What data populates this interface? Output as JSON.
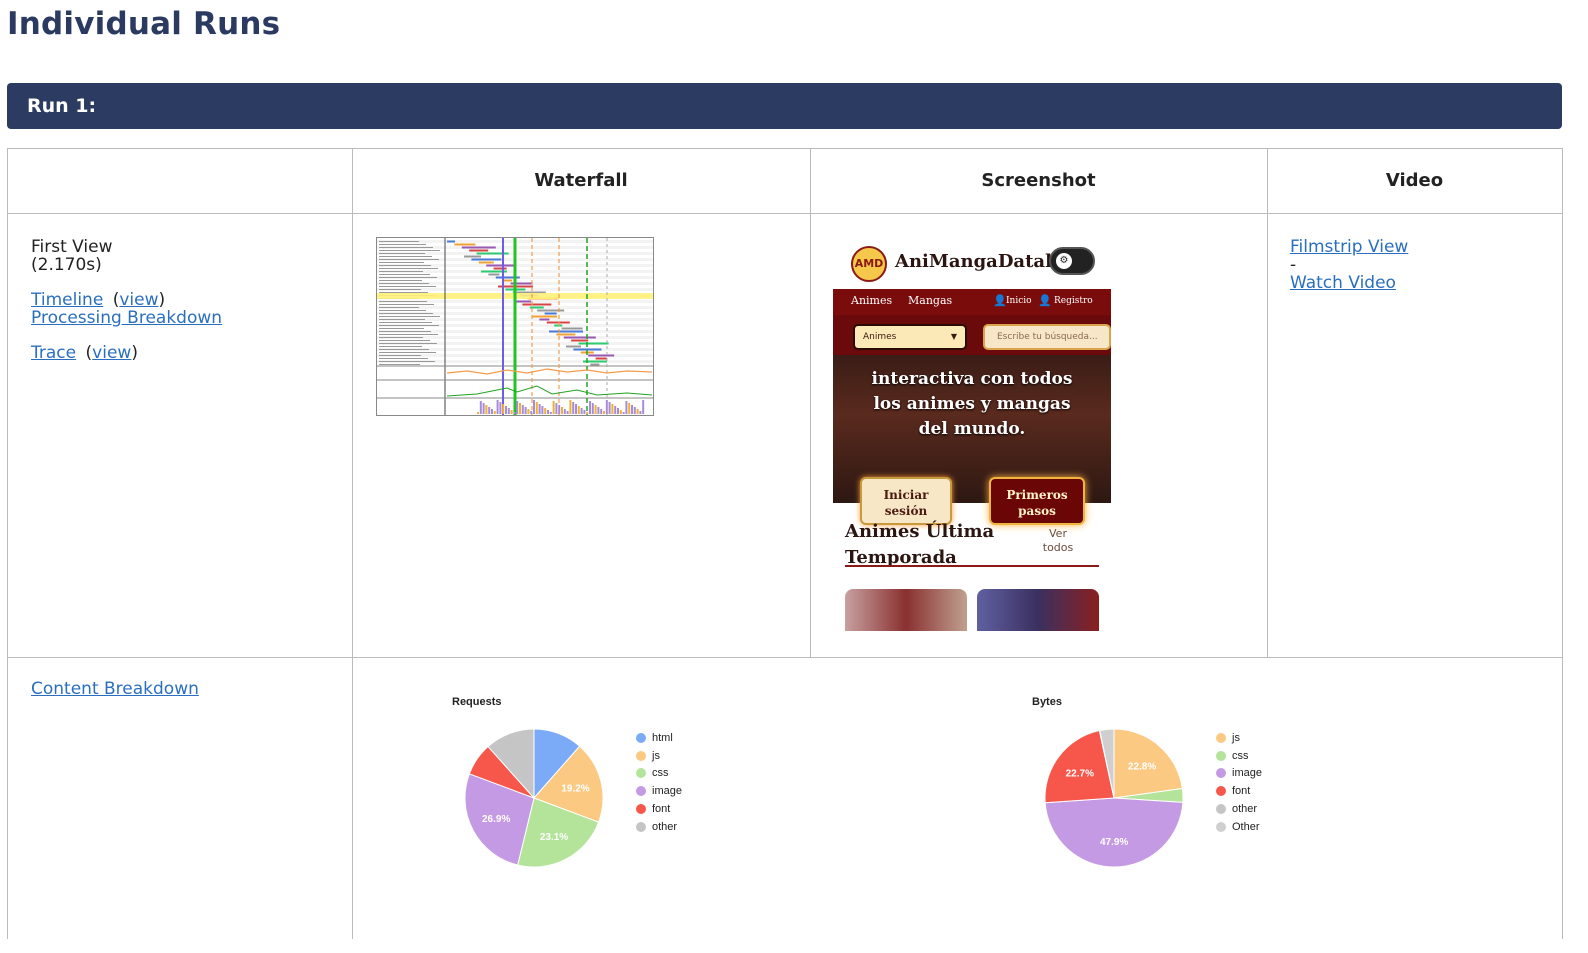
{
  "page_title": "Individual Runs",
  "run": {
    "label": "Run 1:"
  },
  "table": {
    "headers": [
      "Waterfall",
      "Screenshot",
      "Video"
    ],
    "first_view": {
      "label": "First View",
      "time": "(2.170s)",
      "timeline_link": "Timeline",
      "view_link": "view",
      "processing_link": "Processing Breakdown",
      "trace_link": "Trace",
      "trace_view_link": "view",
      "open_paren": "(",
      "close_paren": ")"
    },
    "video": {
      "filmstrip_link": "Filmstrip View",
      "separator": "-",
      "watch_link": "Watch Video"
    },
    "content_breakdown_link": "Content Breakdown"
  },
  "screenshot": {
    "brand": "AniMangaDatahub",
    "logo_text": "AMD",
    "nav": [
      "Animes",
      "Mangas",
      "Inicio",
      "Registro"
    ],
    "select_value": "Animes",
    "search_placeholder": "Escribe tu búsqueda...",
    "hero_line1": "interactiva con todos",
    "hero_line2": "los animes y mangas",
    "hero_line3": "del mundo.",
    "login_button": "Iniciar sesión",
    "start_button": "Primeros pasos",
    "season_title_1": "Animes Última",
    "season_title_2": "Temporada",
    "see_all": "Ver todos"
  },
  "chart_data": [
    {
      "type": "pie",
      "title": "Requests",
      "slices": [
        {
          "label": "html",
          "value": 11.5,
          "color": "#7baaf7"
        },
        {
          "label": "js",
          "value": 19.2,
          "color": "#fcc983"
        },
        {
          "label": "css",
          "value": 23.1,
          "color": "#b3e499"
        },
        {
          "label": "image",
          "value": 26.9,
          "color": "#c49ae4"
        },
        {
          "label": "font",
          "value": 7.7,
          "color": "#f7564a"
        },
        {
          "label": "other",
          "value": 11.6,
          "color": "#c5c5c5"
        }
      ],
      "data_labels": [
        "19.2%",
        "23.1%",
        "26.9%"
      ],
      "legend_position": "right"
    },
    {
      "type": "pie",
      "title": "Bytes",
      "slices": [
        {
          "label": "js",
          "value": 22.8,
          "color": "#fcc983"
        },
        {
          "label": "css",
          "value": 3.2,
          "color": "#b3e499"
        },
        {
          "label": "image",
          "value": 47.9,
          "color": "#c49ae4"
        },
        {
          "label": "font",
          "value": 22.7,
          "color": "#f7564a"
        },
        {
          "label": "other",
          "value": 0.1,
          "color": "#c5c5c5"
        },
        {
          "label": "Other",
          "value": 3.3,
          "color": "#cfcfcf"
        }
      ],
      "data_labels": [
        "22.8%",
        "47.9%",
        "22.7%"
      ],
      "legend_position": "right"
    }
  ]
}
